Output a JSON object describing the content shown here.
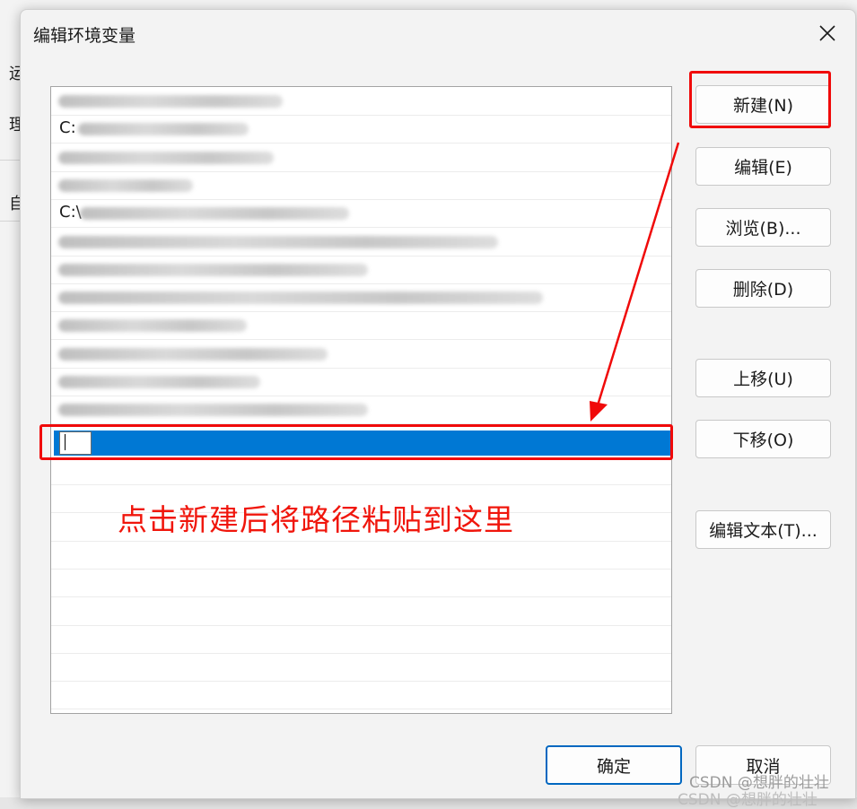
{
  "dialog": {
    "title": "编辑环境变量",
    "close_label": "关闭"
  },
  "background": {
    "fragments": [
      "运",
      "理",
      "自"
    ]
  },
  "path_list": {
    "rows": [
      {
        "prefix": ""
      },
      {
        "prefix": "C:"
      },
      {
        "prefix": ""
      },
      {
        "prefix": ""
      },
      {
        "prefix": "C:\\"
      },
      {
        "prefix": ""
      },
      {
        "prefix": ""
      },
      {
        "prefix": ""
      },
      {
        "prefix": ""
      },
      {
        "prefix": ""
      },
      {
        "prefix": ""
      },
      {
        "prefix": ""
      }
    ],
    "selected_row_value": "",
    "empty_rows": 10
  },
  "buttons": {
    "new": "新建(N)",
    "edit": "编辑(E)",
    "browse": "浏览(B)...",
    "delete": "删除(D)",
    "move_up": "上移(U)",
    "move_down": "下移(O)",
    "edit_text": "编辑文本(T)...",
    "ok": "确定",
    "cancel": "取消"
  },
  "annotation": {
    "text": "点击新建后将路径粘贴到这里",
    "color": "#f00a0a"
  },
  "watermark": {
    "text": "CSDN @想胖的壮壮"
  },
  "colors": {
    "selection": "#0078d4",
    "dialog_bg": "#f3f3f3",
    "ok_border": "#0067c0"
  }
}
